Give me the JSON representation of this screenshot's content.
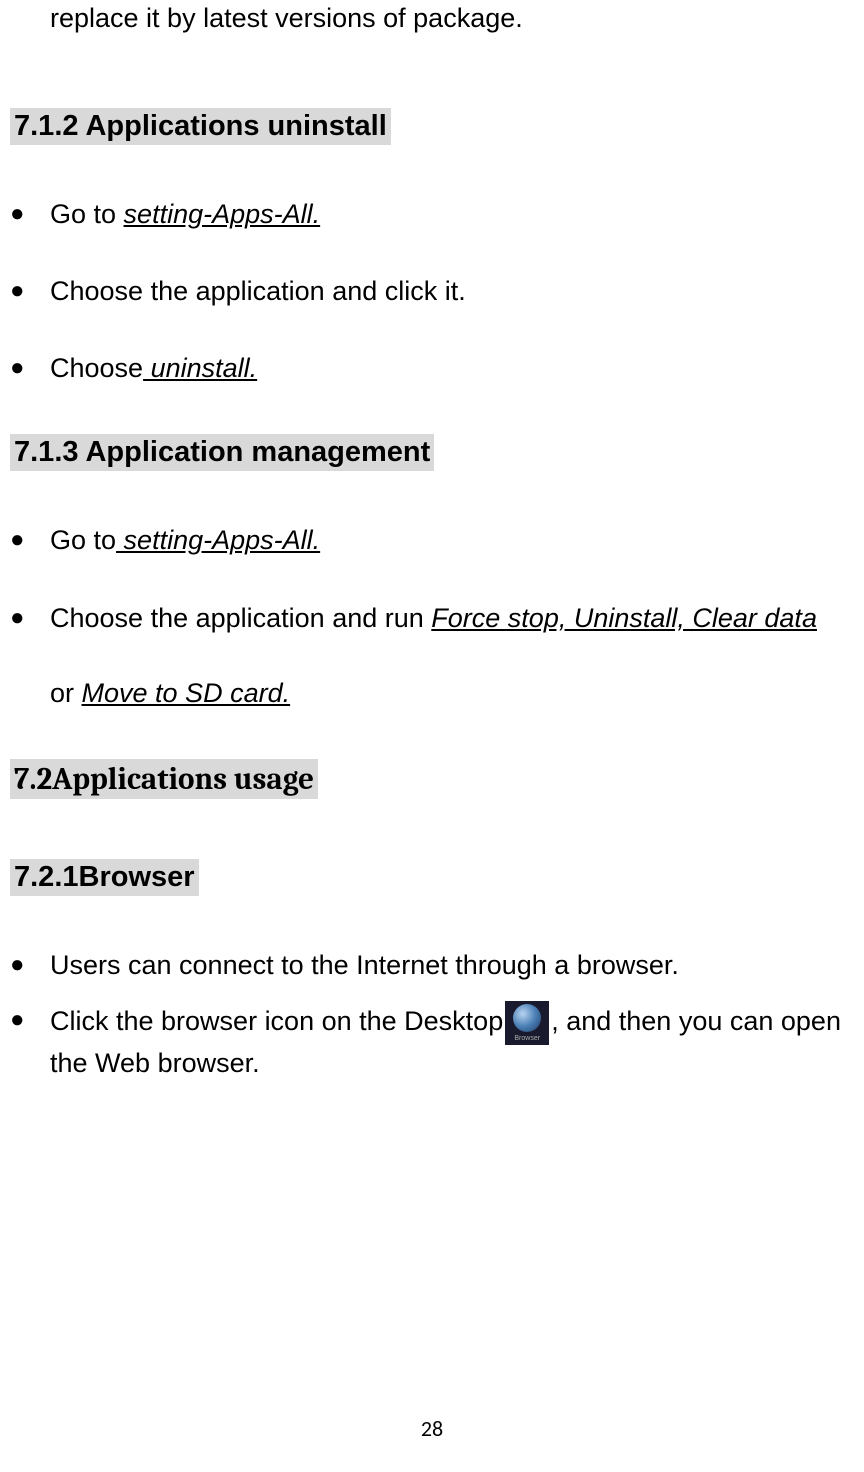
{
  "fragment": "replace it by latest versions of package.",
  "sections": {
    "s712": {
      "heading": "7.1.2 Applications uninstall",
      "items": [
        {
          "prefix": "Go to ",
          "link": "setting-Apps-All."
        },
        {
          "text": "Choose the application and click it."
        },
        {
          "prefix": "Choose",
          "link": " uninstall."
        }
      ]
    },
    "s713": {
      "heading": "7.1.3 Application management",
      "items": [
        {
          "prefix": "Go to",
          "link": " setting-Apps-All."
        },
        {
          "prefix": "Choose the application and run ",
          "link": "Force stop, Uninstall, Clear data",
          "middle": "or ",
          "link2": "Move to SD card."
        }
      ]
    },
    "s72": {
      "heading": "7.2Applications usage"
    },
    "s721": {
      "heading": "7.2.1Browser",
      "items": [
        {
          "text": "Users can connect to the Internet through a browser."
        },
        {
          "prefix": "Click the browser icon on the Desktop",
          "suffix": ", and then you can open the Web browser."
        }
      ]
    }
  },
  "icon": {
    "name": "browser-icon"
  },
  "pageNumber": "28"
}
